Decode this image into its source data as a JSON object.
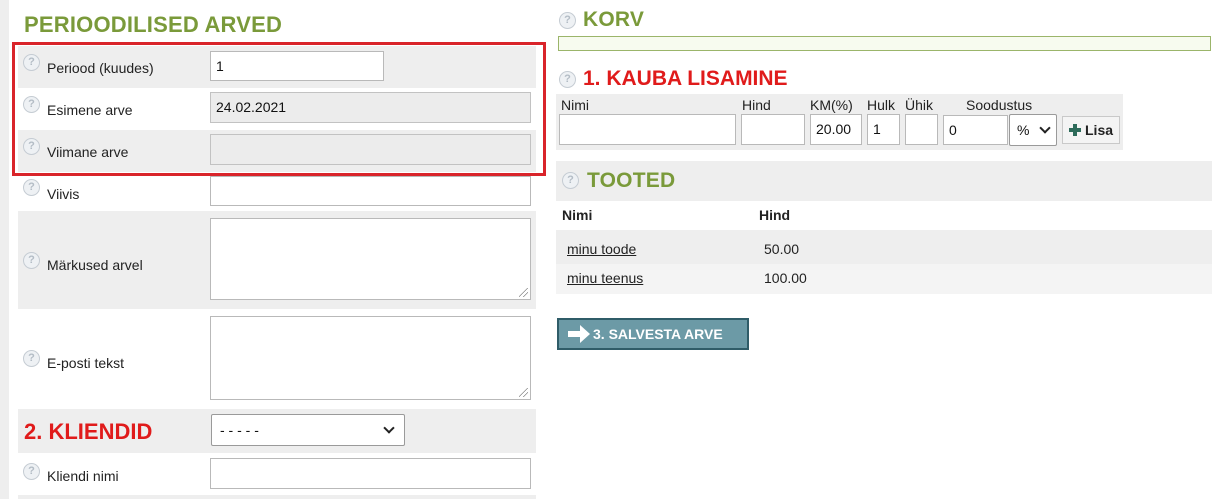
{
  "periodic": {
    "title": "PERIOODILISED ARVED",
    "rows": [
      {
        "label": "Periood (kuudes)",
        "value": ""
      },
      {
        "label": "Esimene arve",
        "value": "24.02.2021"
      },
      {
        "label": "Viimane arve",
        "value": ""
      },
      {
        "label": "Viivis",
        "value": ""
      },
      {
        "label": "Märkused arvel",
        "value": ""
      },
      {
        "label": "E-posti tekst",
        "value": ""
      }
    ],
    "period_value": "1"
  },
  "clients": {
    "title": "2. KLIENDID",
    "select_value": "- - - - -",
    "name_label": "Kliendi nimi",
    "name_value": ""
  },
  "cart": {
    "title": "KORV"
  },
  "add_item": {
    "title": "1. KAUBA LISAMINE",
    "headers": {
      "name": "Nimi",
      "price": "Hind",
      "vat": "KM(%)",
      "qty": "Hulk",
      "unit": "Ühik",
      "discount": "Soodustus"
    },
    "values": {
      "name": "",
      "price": "",
      "vat": "20.00",
      "qty": "1",
      "unit": "",
      "discount": "0",
      "discount_type": "%"
    },
    "add_label": "Lisa"
  },
  "products": {
    "title": "TOOTED",
    "headers": {
      "name": "Nimi",
      "price": "Hind"
    },
    "items": [
      {
        "name": "minu toode",
        "price": "50.00"
      },
      {
        "name": "minu teenus",
        "price": "100.00"
      }
    ]
  },
  "save_label": "3. SALVESTA ARVE",
  "colors": {
    "green_heading": "#7a9a3a",
    "red_heading": "#e01b1b",
    "highlight_box": "#d9242a",
    "save_button": "#6c9aa6"
  }
}
